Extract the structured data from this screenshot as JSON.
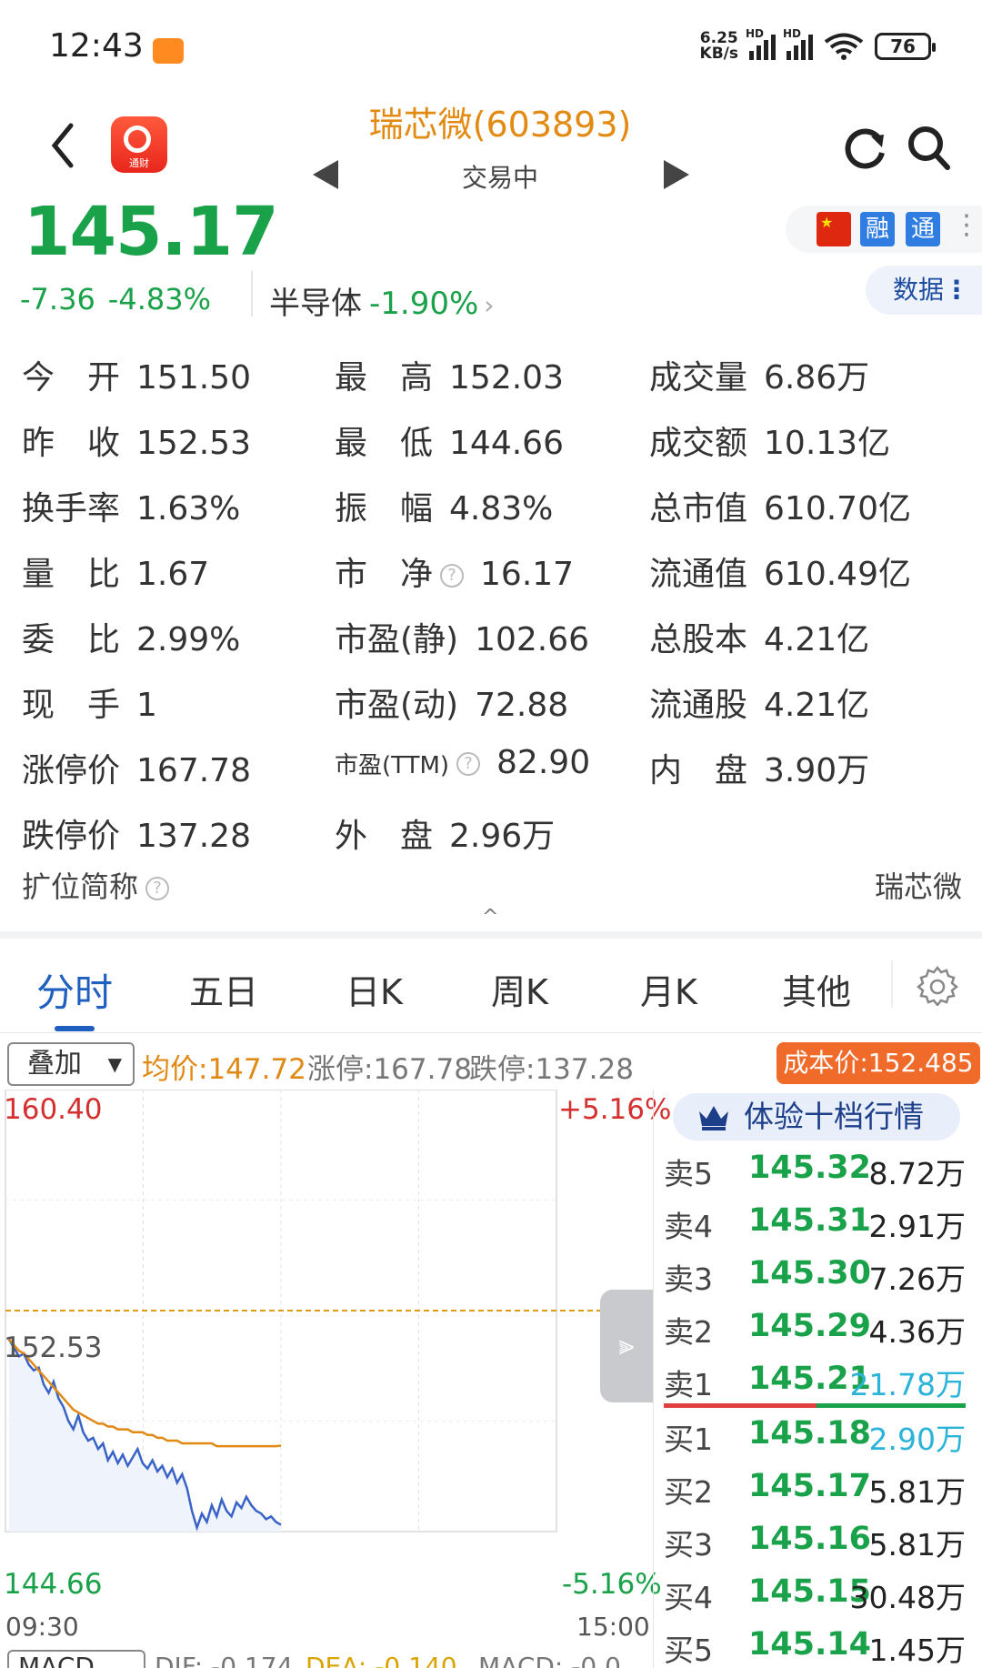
{
  "status_bar": {
    "time": "12:43",
    "net_speed_value": "6.25",
    "net_speed_unit": "KB/s",
    "signal_label": "HD",
    "battery": "76"
  },
  "header": {
    "stock_title": "瑞芯微(603893)",
    "trade_status": "交易中",
    "app_logo_label": "通财"
  },
  "quote": {
    "price": "145.17",
    "change": "-7.36",
    "change_pct": "-4.83%",
    "sector_name": "半导体",
    "sector_pct": "-1.90%",
    "sector_arrow": "›",
    "badges": [
      "融",
      "通"
    ],
    "data_button": "数据"
  },
  "stats": {
    "col1": [
      {
        "label": "今　开",
        "value": "151.50"
      },
      {
        "label": "昨　收",
        "value": "152.53"
      },
      {
        "label": "换手率",
        "value": "1.63%"
      },
      {
        "label": "量　比",
        "value": "1.67"
      },
      {
        "label": "委　比",
        "value": "2.99%"
      },
      {
        "label": "现　手",
        "value": "1"
      },
      {
        "label": "涨停价",
        "value": "167.78"
      },
      {
        "label": "跌停价",
        "value": "137.28"
      }
    ],
    "col2": [
      {
        "label": "最　高",
        "value": "152.03"
      },
      {
        "label": "最　低",
        "value": "144.66"
      },
      {
        "label": "振　幅",
        "value": "4.83%"
      },
      {
        "label": "市　净",
        "value": "16.17"
      },
      {
        "label": "市盈(静)",
        "value": "102.66"
      },
      {
        "label": "市盈(动)",
        "value": "72.88"
      },
      {
        "label": "市盈(TTM)",
        "value": "82.90"
      },
      {
        "label": "外　盘",
        "value": "2.96万"
      }
    ],
    "col3": [
      {
        "label": "成交量",
        "value": "6.86万"
      },
      {
        "label": "成交额",
        "value": "10.13亿"
      },
      {
        "label": "总市值",
        "value": "610.70亿"
      },
      {
        "label": "流通值",
        "value": "610.49亿"
      },
      {
        "label": "总股本",
        "value": "4.21亿"
      },
      {
        "label": "流通股",
        "value": "4.21亿"
      },
      {
        "label": "内　盘",
        "value": "3.90万"
      }
    ],
    "abbr_label": "扩位简称",
    "abbr_value": "瑞芯微",
    "help_glyph": "?",
    "collapse_glyph": "^"
  },
  "tabs": [
    "分时",
    "五日",
    "日K",
    "周K",
    "月K",
    "其他"
  ],
  "overlay": {
    "select_label": "叠加",
    "avg_price": "均价:147.72",
    "limit_up": "涨停:167.78",
    "limit_down": "跌停:137.28",
    "cost_price": "成本价:152.485"
  },
  "chart_data": {
    "type": "line",
    "y_max_label": "160.40",
    "y_max_pct": "+5.16%",
    "y_prev_close": "152.53",
    "y_min_label": "144.66",
    "y_min_pct": "-5.16%",
    "x_start": "09:30",
    "x_end": "15:00",
    "ylim": [
      144.66,
      160.4
    ],
    "prev_close": 152.53,
    "series": [
      {
        "values": [
          151.5,
          151.2,
          150.9,
          151.0,
          150.6,
          150.4,
          150.5,
          149.9,
          149.6,
          150.0,
          149.4,
          149.1,
          148.6,
          148.3,
          148.8,
          148.2,
          147.9,
          148.0,
          147.6,
          147.8,
          147.2,
          147.5,
          147.1,
          147.4,
          147.0,
          147.3,
          147.6,
          147.1,
          146.9,
          147.2,
          146.8,
          147.0,
          146.6,
          146.9,
          146.4,
          146.7,
          146.2,
          145.4,
          144.8,
          145.3,
          145.0,
          145.6,
          145.2,
          145.8,
          145.4,
          145.2,
          145.7,
          145.5,
          145.9,
          145.6,
          145.4,
          145.3,
          145.1,
          145.2,
          145.0,
          144.9
        ]
      },
      {
        "values": [
          151.5,
          151.3,
          151.1,
          151.0,
          150.8,
          150.6,
          150.4,
          150.2,
          150.0,
          149.8,
          149.6,
          149.4,
          149.2,
          149.0,
          148.9,
          148.8,
          148.7,
          148.6,
          148.5,
          148.5,
          148.4,
          148.4,
          148.3,
          148.3,
          148.3,
          148.2,
          148.2,
          148.2,
          148.1,
          148.1,
          148.0,
          148.0,
          147.9,
          147.9,
          147.9,
          147.8,
          147.8,
          147.8,
          147.8,
          147.8,
          147.8,
          147.8,
          147.7,
          147.7,
          147.7,
          147.7,
          147.7,
          147.7,
          147.7,
          147.7,
          147.7,
          147.7,
          147.7,
          147.7,
          147.7,
          147.72
        ]
      }
    ]
  },
  "order_book": {
    "header": "体验十档行情",
    "rows": [
      {
        "side": "卖5",
        "price": "145.32",
        "vol": "8.72万",
        "hl": false
      },
      {
        "side": "卖4",
        "price": "145.31",
        "vol": "2.91万",
        "hl": false
      },
      {
        "side": "卖3",
        "price": "145.30",
        "vol": "7.26万",
        "hl": false
      },
      {
        "side": "卖2",
        "price": "145.29",
        "vol": "4.36万",
        "hl": false
      },
      {
        "side": "卖1",
        "price": "145.21",
        "vol": "21.78万",
        "hl": true
      },
      {
        "side": "买1",
        "price": "145.18",
        "vol": "2.90万",
        "hl": true
      },
      {
        "side": "买2",
        "price": "145.17",
        "vol": "5.81万",
        "hl": false
      },
      {
        "side": "买3",
        "price": "145.16",
        "vol": "5.81万",
        "hl": false
      },
      {
        "side": "买4",
        "price": "145.15",
        "vol": "30.48万",
        "hl": false
      },
      {
        "side": "买5",
        "price": "145.14",
        "vol": "1.45万",
        "hl": false
      }
    ]
  },
  "macd": {
    "select_label": "MACD",
    "dif": "DIF: -0.174",
    "dea": "DEA: -0.140",
    "macd": "MACD: -0.0..."
  },
  "colors": {
    "down": "#1aa24a",
    "up": "#d43030",
    "accent": "#1e5fbf",
    "price_line": "#3a63c8",
    "avg_line": "#e08a14"
  }
}
